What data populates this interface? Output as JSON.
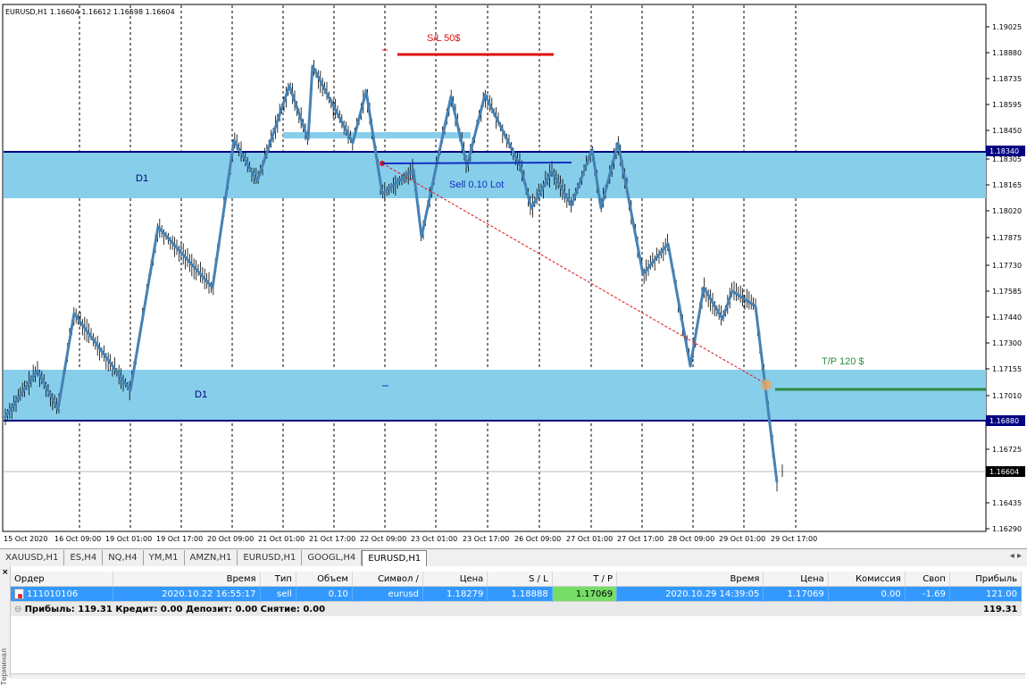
{
  "chart": {
    "header": "EURUSD,H1  1.16604 1.16612 1.16598 1.16604",
    "price_ticks": [
      "1.19025",
      "1.18880",
      "1.18735",
      "1.18595",
      "1.18450",
      "1.18305",
      "1.18165",
      "1.18020",
      "1.17875",
      "1.17730",
      "1.17585",
      "1.17440",
      "1.17300",
      "1.17155",
      "1.17010",
      "1.16725",
      "1.16580",
      "1.16435",
      "1.16290"
    ],
    "marker_upper": "1.18340",
    "marker_lower": "1.16880",
    "marker_current": "1.16604",
    "time_ticks": [
      "15 Oct 2020",
      "16 Oct 09:00",
      "19 Oct 01:00",
      "19 Oct 17:00",
      "20 Oct 09:00",
      "21 Oct 01:00",
      "21 Oct 17:00",
      "22 Oct 09:00",
      "23 Oct 01:00",
      "23 Oct 17:00",
      "26 Oct 09:00",
      "27 Oct 01:00",
      "27 Oct 17:00",
      "28 Oct 09:00",
      "29 Oct 01:00",
      "29 Oct 17:00"
    ],
    "zone_upper_label": "D1",
    "zone_lower_label": "D1",
    "sl_label": "S/L 50$",
    "tp_label": "T/P 120 $",
    "sell_label": "Sell 0.10 Lot",
    "colors": {
      "zone": "#87ceeb",
      "zone_line": "#000080",
      "zigzag": "#4682b4",
      "sl": "#e01010",
      "tp": "#2e8b3e",
      "sell": "#1030c0"
    }
  },
  "tabs": {
    "items": [
      "XAUUSD,H1",
      "ES,H4",
      "NQ,H4",
      "YM,M1",
      "AMZN,H1",
      "EURUSD,H1",
      "GOOGL,H4",
      "EURUSD,H1"
    ],
    "active": 7,
    "arrows": "◂ ▸"
  },
  "terminal": {
    "side_label": "Терминал",
    "close_glyph": "×",
    "columns": [
      "Ордер",
      "Время",
      "Тип",
      "Объем",
      "Символ",
      "Цена",
      "S / L",
      "T / P",
      "Время",
      "Цена",
      "Комиссия",
      "Своп",
      "Прибыль"
    ],
    "sort_mark": "/",
    "order": {
      "id": "111010106",
      "open_time": "2020.10.22 16:55:17",
      "type": "sell",
      "volume": "0.10",
      "symbol": "eurusd",
      "price": "1.18279",
      "sl": "1.18888",
      "tp": "1.17069",
      "close_time": "2020.10.29 14:39:05",
      "close_price": "1.17069",
      "commission": "0.00",
      "swap": "-1.69",
      "profit": "121.00"
    },
    "summary": {
      "text": "Прибыль: 119.31  Кредит: 0.00  Депозит: 0.00  Снятие: 0.00",
      "total": "119.31"
    }
  }
}
